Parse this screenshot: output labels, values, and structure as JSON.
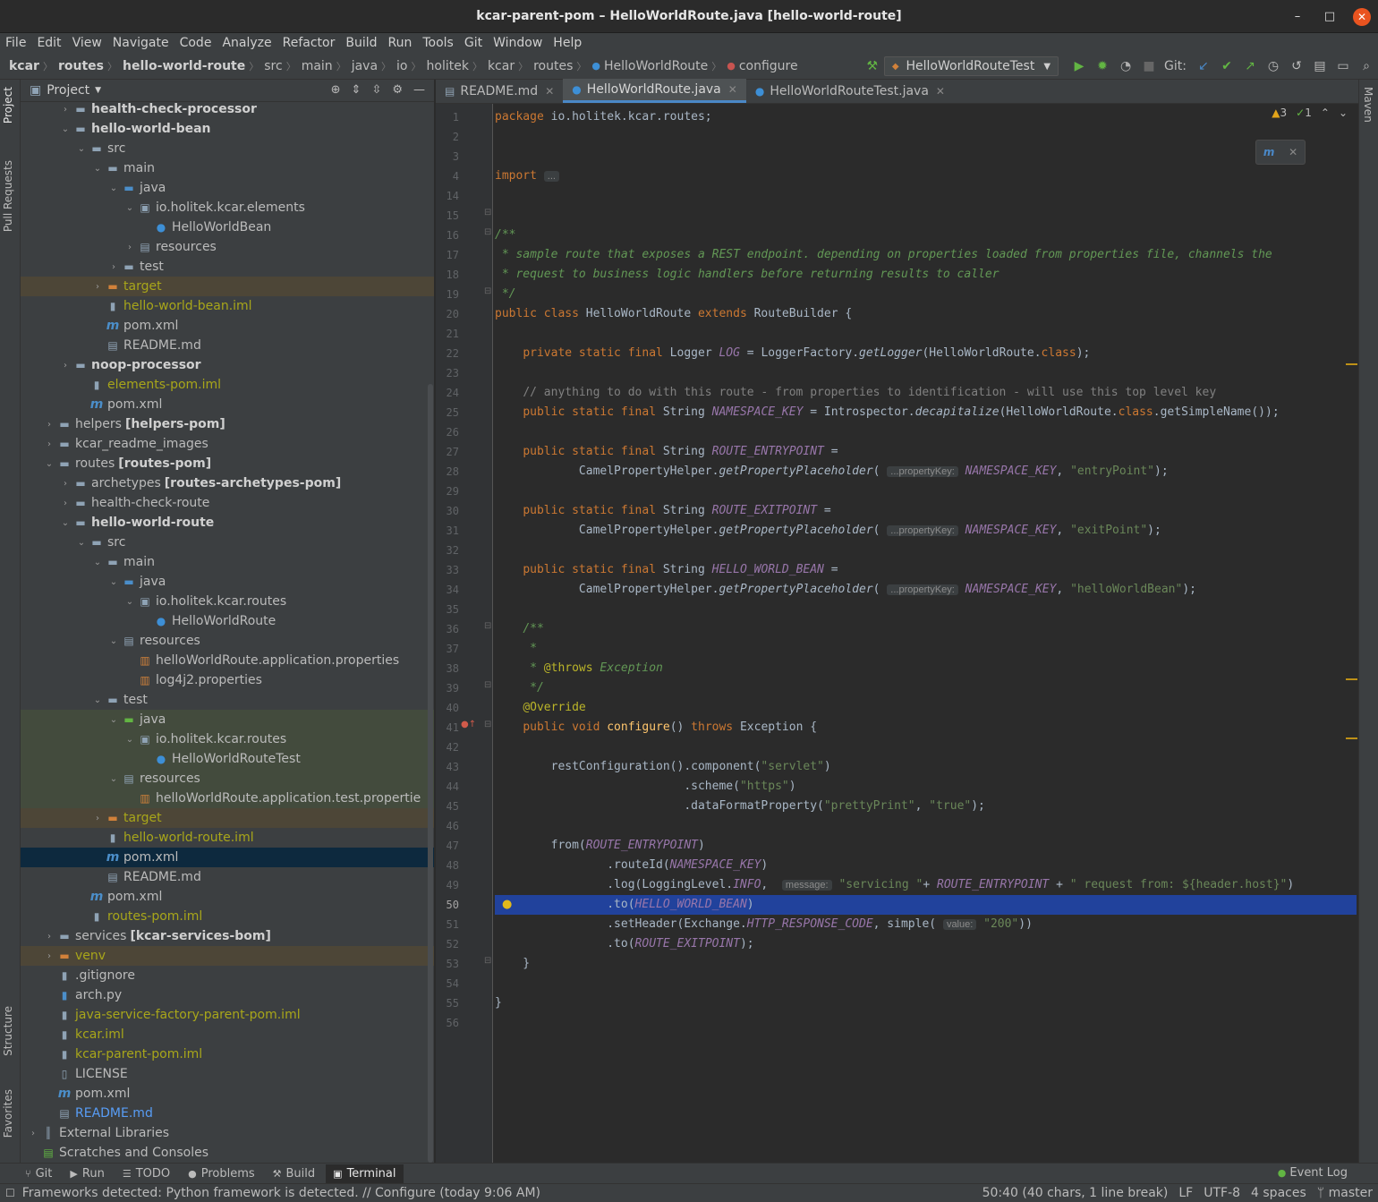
{
  "window": {
    "title": "kcar-parent-pom – HelloWorldRoute.java [hello-world-route]",
    "min": "–",
    "max": "□",
    "close": "✕"
  },
  "menu": [
    "File",
    "Edit",
    "View",
    "Navigate",
    "Code",
    "Analyze",
    "Refactor",
    "Build",
    "Run",
    "Tools",
    "Git",
    "Window",
    "Help"
  ],
  "breadcrumbs": [
    "kcar",
    "routes",
    "hello-world-route",
    "src",
    "main",
    "java",
    "io",
    "holitek",
    "kcar",
    "routes",
    "HelloWorldRoute",
    "configure"
  ],
  "toolbar": {
    "run_config": "HelloWorldRouteTest",
    "git_label": "Git:"
  },
  "sidestrip": {
    "project": "Project",
    "pull_requests": "Pull Requests",
    "structure": "Structure",
    "favorites": "Favorites",
    "maven": "Maven"
  },
  "project_panel": {
    "title": "Project"
  },
  "tree": [
    {
      "d": 2,
      "a": "r",
      "i": "fold",
      "t": "health-check-processor",
      "s": "bold"
    },
    {
      "d": 2,
      "a": "d",
      "i": "fold",
      "t": "hello-world-bean",
      "s": "bold"
    },
    {
      "d": 3,
      "a": "d",
      "i": "src",
      "t": "src"
    },
    {
      "d": 4,
      "a": "d",
      "i": "fold",
      "t": "main"
    },
    {
      "d": 5,
      "a": "d",
      "i": "java",
      "t": "java"
    },
    {
      "d": 6,
      "a": "d",
      "i": "pkg",
      "t": "io.holitek.kcar.elements"
    },
    {
      "d": 7,
      "a": "n",
      "i": "cls",
      "t": "HelloWorldBean"
    },
    {
      "d": 6,
      "a": "r",
      "i": "res",
      "t": "resources"
    },
    {
      "d": 5,
      "a": "r",
      "i": "fold",
      "t": "test"
    },
    {
      "d": 4,
      "a": "r",
      "i": "target",
      "t": "target",
      "s": "ign",
      "h": "target"
    },
    {
      "d": 4,
      "a": "n",
      "i": "iml",
      "t": "hello-world-bean.iml",
      "s": "ign"
    },
    {
      "d": 4,
      "a": "n",
      "i": "pom",
      "t": "pom.xml"
    },
    {
      "d": 4,
      "a": "n",
      "i": "md",
      "t": "README.md"
    },
    {
      "d": 2,
      "a": "r",
      "i": "fold",
      "t": "noop-processor",
      "s": "bold"
    },
    {
      "d": 3,
      "a": "n",
      "i": "iml",
      "t": "elements-pom.iml",
      "s": "ign"
    },
    {
      "d": 3,
      "a": "n",
      "i": "pom",
      "t": "pom.xml"
    },
    {
      "d": 1,
      "a": "r",
      "i": "fold",
      "t": "helpers",
      "x": "[helpers-pom]"
    },
    {
      "d": 1,
      "a": "r",
      "i": "fold",
      "t": "kcar_readme_images"
    },
    {
      "d": 1,
      "a": "d",
      "i": "fold",
      "t": "routes",
      "x": "[routes-pom]"
    },
    {
      "d": 2,
      "a": "r",
      "i": "fold",
      "t": "archetypes",
      "x": "[routes-archetypes-pom]"
    },
    {
      "d": 2,
      "a": "r",
      "i": "fold",
      "t": "health-check-route"
    },
    {
      "d": 2,
      "a": "d",
      "i": "fold",
      "t": "hello-world-route",
      "s": "bold"
    },
    {
      "d": 3,
      "a": "d",
      "i": "src",
      "t": "src"
    },
    {
      "d": 4,
      "a": "d",
      "i": "fold",
      "t": "main"
    },
    {
      "d": 5,
      "a": "d",
      "i": "java",
      "t": "java"
    },
    {
      "d": 6,
      "a": "d",
      "i": "pkg",
      "t": "io.holitek.kcar.routes"
    },
    {
      "d": 7,
      "a": "n",
      "i": "cls",
      "t": "HelloWorldRoute"
    },
    {
      "d": 5,
      "a": "d",
      "i": "res",
      "t": "resources"
    },
    {
      "d": 6,
      "a": "n",
      "i": "prop",
      "t": "helloWorldRoute.application.properties"
    },
    {
      "d": 6,
      "a": "n",
      "i": "prop",
      "t": "log4j2.properties"
    },
    {
      "d": 4,
      "a": "d",
      "i": "fold",
      "t": "test"
    },
    {
      "d": 5,
      "a": "d",
      "i": "testjava",
      "t": "java",
      "h": "test"
    },
    {
      "d": 6,
      "a": "d",
      "i": "pkg",
      "t": "io.holitek.kcar.routes",
      "h": "test"
    },
    {
      "d": 7,
      "a": "n",
      "i": "cls",
      "t": "HelloWorldRouteTest",
      "h": "test"
    },
    {
      "d": 5,
      "a": "d",
      "i": "res",
      "t": "resources",
      "h": "test"
    },
    {
      "d": 6,
      "a": "n",
      "i": "prop",
      "t": "helloWorldRoute.application.test.propertie",
      "h": "test"
    },
    {
      "d": 4,
      "a": "r",
      "i": "target",
      "t": "target",
      "s": "ign",
      "h": "target"
    },
    {
      "d": 4,
      "a": "n",
      "i": "iml",
      "t": "hello-world-route.iml",
      "s": "ign"
    },
    {
      "d": 4,
      "a": "n",
      "i": "pom",
      "t": "pom.xml",
      "h": "sel"
    },
    {
      "d": 4,
      "a": "n",
      "i": "md",
      "t": "README.md"
    },
    {
      "d": 3,
      "a": "n",
      "i": "pom",
      "t": "pom.xml"
    },
    {
      "d": 3,
      "a": "n",
      "i": "iml",
      "t": "routes-pom.iml",
      "s": "ign"
    },
    {
      "d": 1,
      "a": "r",
      "i": "fold",
      "t": "services",
      "x": "[kcar-services-bom]"
    },
    {
      "d": 1,
      "a": "r",
      "i": "target",
      "t": "venv",
      "s": "ign",
      "h": "target"
    },
    {
      "d": 1,
      "a": "n",
      "i": "git",
      "t": ".gitignore"
    },
    {
      "d": 1,
      "a": "n",
      "i": "py",
      "t": "arch.py"
    },
    {
      "d": 1,
      "a": "n",
      "i": "iml",
      "t": "java-service-factory-parent-pom.iml",
      "s": "ign"
    },
    {
      "d": 1,
      "a": "n",
      "i": "iml",
      "t": "kcar.iml",
      "s": "ign"
    },
    {
      "d": 1,
      "a": "n",
      "i": "iml",
      "t": "kcar-parent-pom.iml",
      "s": "ign"
    },
    {
      "d": 1,
      "a": "n",
      "i": "lic",
      "t": "LICENSE"
    },
    {
      "d": 1,
      "a": "n",
      "i": "pom",
      "t": "pom.xml"
    },
    {
      "d": 1,
      "a": "n",
      "i": "md",
      "t": "README.md",
      "s": "mdl"
    },
    {
      "d": 0,
      "a": "r",
      "i": "lib",
      "t": "External Libraries"
    },
    {
      "d": 0,
      "a": "n",
      "i": "scratch",
      "t": "Scratches and Consoles"
    }
  ],
  "tabs": [
    {
      "label": "README.md",
      "active": false
    },
    {
      "label": "HelloWorldRoute.java",
      "active": true
    },
    {
      "label": "HelloWorldRouteTest.java",
      "active": false
    }
  ],
  "inspection": {
    "warnings": "3",
    "ok": "1"
  },
  "code": [
    {
      "n": "1",
      "t": "[[kw|package]] io.holitek.kcar.routes;"
    },
    {
      "n": "2",
      "t": ""
    },
    {
      "n": "3",
      "t": ""
    },
    {
      "n": "4",
      "t": "[[kw|import]] [[hint|...]]"
    },
    {
      "n": "14",
      "t": ""
    },
    {
      "n": "15",
      "t": ""
    },
    {
      "n": "16",
      "t": "[[doc|/**]]"
    },
    {
      "n": "17",
      "t": "[[doc| * sample route that exposes a REST endpoint. depending on properties loaded from properties file, channels the]]"
    },
    {
      "n": "18",
      "t": "[[doc| * request to business logic handlers before returning results to caller]]"
    },
    {
      "n": "19",
      "t": "[[doc| */]]"
    },
    {
      "n": "20",
      "t": "[[kw|public class]] HelloWorldRoute [[kw|extends]] RouteBuilder {"
    },
    {
      "n": "21",
      "t": ""
    },
    {
      "n": "22",
      "t": "    [[kw|private static final]] Logger [[fd|LOG]] = LoggerFactory.[[sm|getLogger]](HelloWorldRoute.[[kw|class]]);"
    },
    {
      "n": "23",
      "t": ""
    },
    {
      "n": "24",
      "t": "    [[cmt|// anything to do with this route - from properties to identification - will use this top level key]]"
    },
    {
      "n": "25",
      "t": "    [[kw|public static final]] String [[fd|NAMESPACE_KEY]] = Introspector.[[sm|decapitalize]](HelloWorldRoute.[[kw|class]].getSimpleName());"
    },
    {
      "n": "26",
      "t": ""
    },
    {
      "n": "27",
      "t": "    [[kw|public static final]] String [[fd|ROUTE_ENTRYPOINT]] ="
    },
    {
      "n": "28",
      "t": "            CamelPropertyHelper.[[sm|getPropertyPlaceholder]]( [[hint|...propertyKey:]] [[fd|NAMESPACE_KEY]], [[st|\"entryPoint\"]]);"
    },
    {
      "n": "29",
      "t": ""
    },
    {
      "n": "30",
      "t": "    [[kw|public static final]] String [[fd|ROUTE_EXITPOINT]] ="
    },
    {
      "n": "31",
      "t": "            CamelPropertyHelper.[[sm|getPropertyPlaceholder]]( [[hint|...propertyKey:]] [[fd|NAMESPACE_KEY]], [[st|\"exitPoint\"]]);"
    },
    {
      "n": "32",
      "t": ""
    },
    {
      "n": "33",
      "t": "    [[kw|public static final]] String [[fd|HELLO_WORLD_BEAN]] ="
    },
    {
      "n": "34",
      "t": "            CamelPropertyHelper.[[sm|getPropertyPlaceholder]]( [[hint|...propertyKey:]] [[fd|NAMESPACE_KEY]], [[st|\"helloWorldBean\"]]);"
    },
    {
      "n": "35",
      "t": ""
    },
    {
      "n": "36",
      "t": "    [[doc|/**]]"
    },
    {
      "n": "37",
      "t": "    [[doc| *]]"
    },
    {
      "n": "38",
      "t": "    [[doc| * ]][[an|@throws]][[doc| Exception]]"
    },
    {
      "n": "39",
      "t": "    [[doc| */]]"
    },
    {
      "n": "40",
      "t": "    [[an|@Override]]"
    },
    {
      "n": "41",
      "t": "    [[kw|public void]] [[fn|configure]]() [[kw|throws]] Exception {"
    },
    {
      "n": "42",
      "t": ""
    },
    {
      "n": "43",
      "t": "        restConfiguration().component([[st|\"servlet\"]])"
    },
    {
      "n": "44",
      "t": "                           .scheme([[st|\"https\"]])"
    },
    {
      "n": "45",
      "t": "                           .dataFormatProperty([[st|\"prettyPrint\"]], [[st|\"true\"]]);"
    },
    {
      "n": "46",
      "t": ""
    },
    {
      "n": "47",
      "t": "        from([[fd|ROUTE_ENTRYPOINT]])"
    },
    {
      "n": "48",
      "t": "                .routeId([[fd|NAMESPACE_KEY]])"
    },
    {
      "n": "49",
      "t": "                .log(LoggingLevel.[[fd|INFO]],  [[hint|message:]] [[st|\"servicing \"]]+ [[fd|ROUTE_ENTRYPOINT]] + [[st|\" request from: ${header.host}\"]])"
    },
    {
      "n": "50",
      "t": "                .to([[fd|HELLO_WORLD_BEAN]])",
      "cur": true
    },
    {
      "n": "51",
      "t": "                .setHeader(Exchange.[[fd|HTTP_RESPONSE_CODE]], simple( [[hint|value:]] [[st|\"200\"]]))"
    },
    {
      "n": "52",
      "t": "                .to([[fd|ROUTE_EXITPOINT]]);"
    },
    {
      "n": "53",
      "t": "    }"
    },
    {
      "n": "54",
      "t": ""
    },
    {
      "n": "55",
      "t": "}"
    },
    {
      "n": "56",
      "t": ""
    }
  ],
  "bottom_tools": [
    {
      "icon": "git-icon",
      "glyph": "⑂",
      "label": "Git"
    },
    {
      "icon": "run-icon",
      "glyph": "▶",
      "label": "Run"
    },
    {
      "icon": "todo-icon",
      "glyph": "☰",
      "label": "TODO"
    },
    {
      "icon": "problems-icon",
      "glyph": "●",
      "label": "Problems"
    },
    {
      "icon": "build-icon",
      "glyph": "⚒",
      "label": "Build"
    },
    {
      "icon": "terminal-icon",
      "glyph": "▣",
      "label": "Terminal",
      "active": true
    }
  ],
  "event_log": "Event Log",
  "status": {
    "message": "Frameworks detected: Python framework is detected. // Configure (today 9:06 AM)",
    "position": "50:40 (40 chars, 1 line break)",
    "line_sep": "LF",
    "encoding": "UTF-8",
    "indent": "4 spaces",
    "branch": "master"
  }
}
